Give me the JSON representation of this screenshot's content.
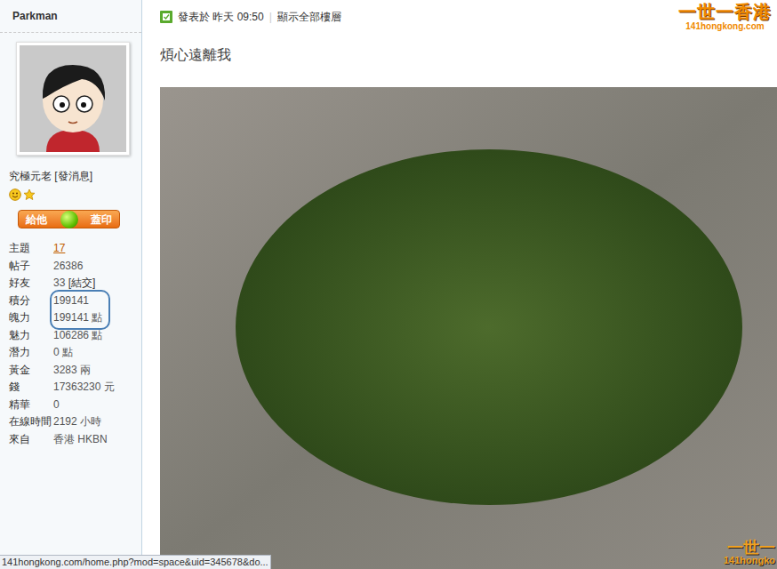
{
  "user": {
    "name": "Parkman",
    "rank": "究極元老",
    "message_link": "[發消息]",
    "stamp_button": {
      "left": "給他",
      "right": "蓋印"
    }
  },
  "stats": [
    {
      "label": "主題",
      "value": "17",
      "extra": "",
      "link": true,
      "highlighted": false
    },
    {
      "label": "帖子",
      "value": "26386",
      "extra": "",
      "link": false,
      "highlighted": false
    },
    {
      "label": "好友",
      "value": "33",
      "extra": "[結交]",
      "link": false,
      "highlighted": false
    },
    {
      "label": "積分",
      "value": "199141",
      "extra": "",
      "link": false,
      "highlighted": true
    },
    {
      "label": "魄力",
      "value": "199141 點",
      "extra": "",
      "link": false,
      "highlighted": true
    },
    {
      "label": "魅力",
      "value": "106286 點",
      "extra": "",
      "link": false,
      "highlighted": false
    },
    {
      "label": "潛力",
      "value": "0 點",
      "extra": "",
      "link": false,
      "highlighted": false
    },
    {
      "label": "黃金",
      "value": "3283 兩",
      "extra": "",
      "link": false,
      "highlighted": false
    },
    {
      "label": "錢",
      "value": "17363230 元",
      "extra": "",
      "link": false,
      "highlighted": false
    },
    {
      "label": "精華",
      "value": "0",
      "extra": "",
      "link": false,
      "highlighted": false
    },
    {
      "label": "在線時間",
      "value": "2192 小時",
      "extra": "",
      "link": false,
      "highlighted": false
    },
    {
      "label": "來自",
      "value": "香港 HKBN",
      "extra": "",
      "link": false,
      "highlighted": false
    }
  ],
  "post": {
    "meta": "發表於 昨天 09:50",
    "show_all": "顯示全部樓層",
    "title": "煩心遠離我"
  },
  "logo": {
    "name": "一世一香港",
    "url": "141hongkong.com"
  },
  "watermark": {
    "name": "一世一",
    "url": "141hongko"
  },
  "status_bar": "141hongkong.com/home.php?mod=space&uid=345678&do..."
}
